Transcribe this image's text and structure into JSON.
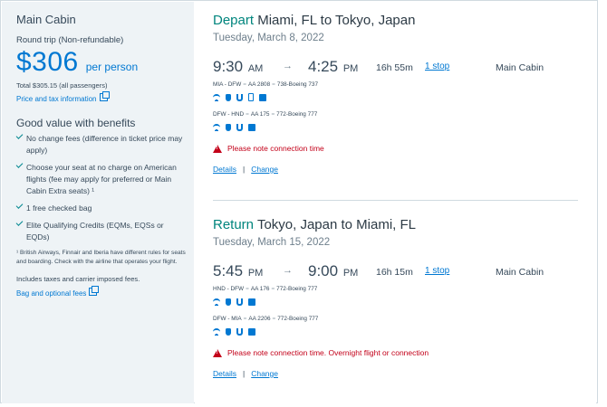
{
  "sidebar": {
    "cabin": "Main Cabin",
    "trip_type": "Round trip (Non-refundable)",
    "price": "$306",
    "per_person": "per person",
    "total": "Total $305.15 (all passengers)",
    "price_tax_link": "Price and tax information",
    "good_value": "Good value with benefits",
    "benefits": [
      "No change fees (difference in ticket price may apply)",
      "Choose your seat at no charge on American flights (fee may apply for preferred or Main Cabin Extra seats) ¹",
      "1 free checked bag",
      "Elite Qualifying Credits (EQMs, EQSs or EQDs)"
    ],
    "footnote": "¹ British Airways, Finnair and Iberia have different rules for seats and boarding. Check with the airline that operates your flight.",
    "includes": "Includes taxes and carrier imposed fees.",
    "bag_fees_link": "Bag and optional fees"
  },
  "depart": {
    "direction": "Depart",
    "route": "Miami, FL to Tokyo, Japan",
    "date": "Tuesday, March 8, 2022",
    "dep_time": "9:30",
    "dep_ampm": "AM",
    "arr_time": "4:25",
    "arr_ampm": "PM",
    "arrow": "→",
    "duration": "16h 55m",
    "stops": "1 stop",
    "cabin": "Main Cabin",
    "seg1": {
      "route": "MIA - DFW",
      "flight": "AA 2808",
      "aircraft": "738-Boeing 737"
    },
    "seg2": {
      "route": "DFW - HND",
      "flight": "AA 175",
      "aircraft": "772-Boeing 777"
    },
    "warning": "Please note connection time",
    "details": "Details",
    "change": "Change",
    "sep": "|",
    "dot": "="
  },
  "return": {
    "direction": "Return",
    "route": "Tokyo, Japan to Miami, FL",
    "date": "Tuesday, March 15, 2022",
    "dep_time": "5:45",
    "dep_ampm": "PM",
    "arr_time": "9:00",
    "arr_ampm": "PM",
    "arrow": "→",
    "duration": "16h 15m",
    "stops": "1 stop",
    "cabin": "Main Cabin",
    "seg1": {
      "route": "HND - DFW",
      "flight": "AA 176",
      "aircraft": "772-Boeing 777"
    },
    "seg2": {
      "route": "DFW - MIA",
      "flight": "AA 2206",
      "aircraft": "772-Boeing 777"
    },
    "warning": "Please note connection time. Overnight flight or connection",
    "details": "Details",
    "change": "Change",
    "sep": "|",
    "dot": "="
  },
  "icons": {
    "wifi": "wifi-icon",
    "power": "power-icon",
    "usb": "usb-icon",
    "phone": "phone-icon",
    "entertainment": "entertainment-icon"
  },
  "colors": {
    "accent": "#0078d2",
    "direction": "#00857d",
    "warning": "#c30019",
    "sidebar_bg": "#eef3f6"
  }
}
